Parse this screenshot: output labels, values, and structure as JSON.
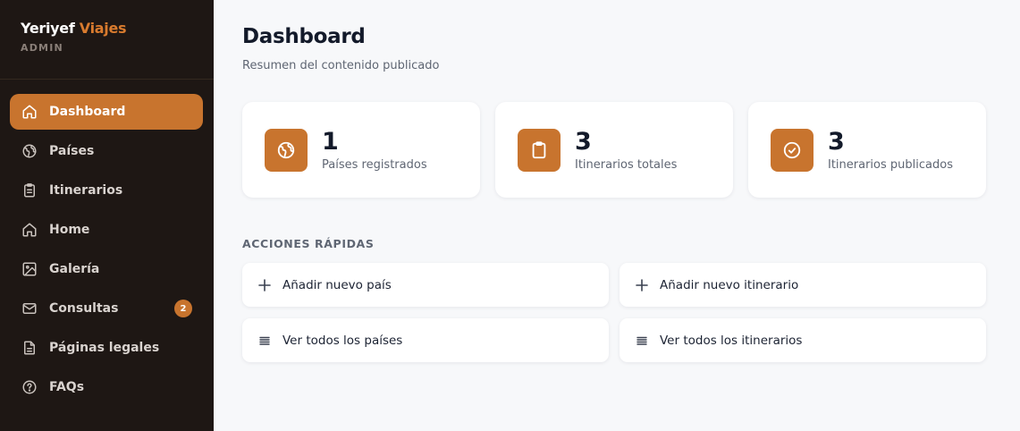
{
  "brand": {
    "name_part1": "Yeriyef",
    "name_part2": "Viajes",
    "subtitle": "ADMIN",
    "accent_color": "#d97b2e"
  },
  "sidebar": {
    "items": [
      {
        "label": "Dashboard",
        "icon": "home-icon",
        "active": true
      },
      {
        "label": "Países",
        "icon": "globe-icon"
      },
      {
        "label": "Itinerarios",
        "icon": "clipboard-icon"
      },
      {
        "label": "Home",
        "icon": "home-icon"
      },
      {
        "label": "Galería",
        "icon": "image-icon"
      },
      {
        "label": "Consultas",
        "icon": "mail-icon",
        "badge": "2"
      },
      {
        "label": "Páginas legales",
        "icon": "document-icon"
      },
      {
        "label": "FAQs",
        "icon": "help-circle-icon"
      }
    ]
  },
  "main": {
    "title": "Dashboard",
    "subtitle": "Resumen del contenido publicado",
    "stats": [
      {
        "value": "1",
        "label": "Países registrados",
        "icon": "globe-icon"
      },
      {
        "value": "3",
        "label": "Itinerarios totales",
        "icon": "clipboard-icon"
      },
      {
        "value": "3",
        "label": "Itinerarios publicados",
        "icon": "check-circle-icon"
      }
    ],
    "quick_actions_title": "ACCIONES RÁPIDAS",
    "actions": [
      {
        "label": "Añadir nuevo país",
        "icon": "plus-icon"
      },
      {
        "label": "Añadir nuevo itinerario",
        "icon": "plus-icon"
      },
      {
        "label": "Ver todos los países",
        "icon": "list-icon"
      },
      {
        "label": "Ver todos los itinerarios",
        "icon": "list-icon"
      }
    ]
  },
  "colors": {
    "primary": "#c8742e",
    "sidebar_bg": "#1e1714",
    "page_bg": "#f7f8fa"
  }
}
